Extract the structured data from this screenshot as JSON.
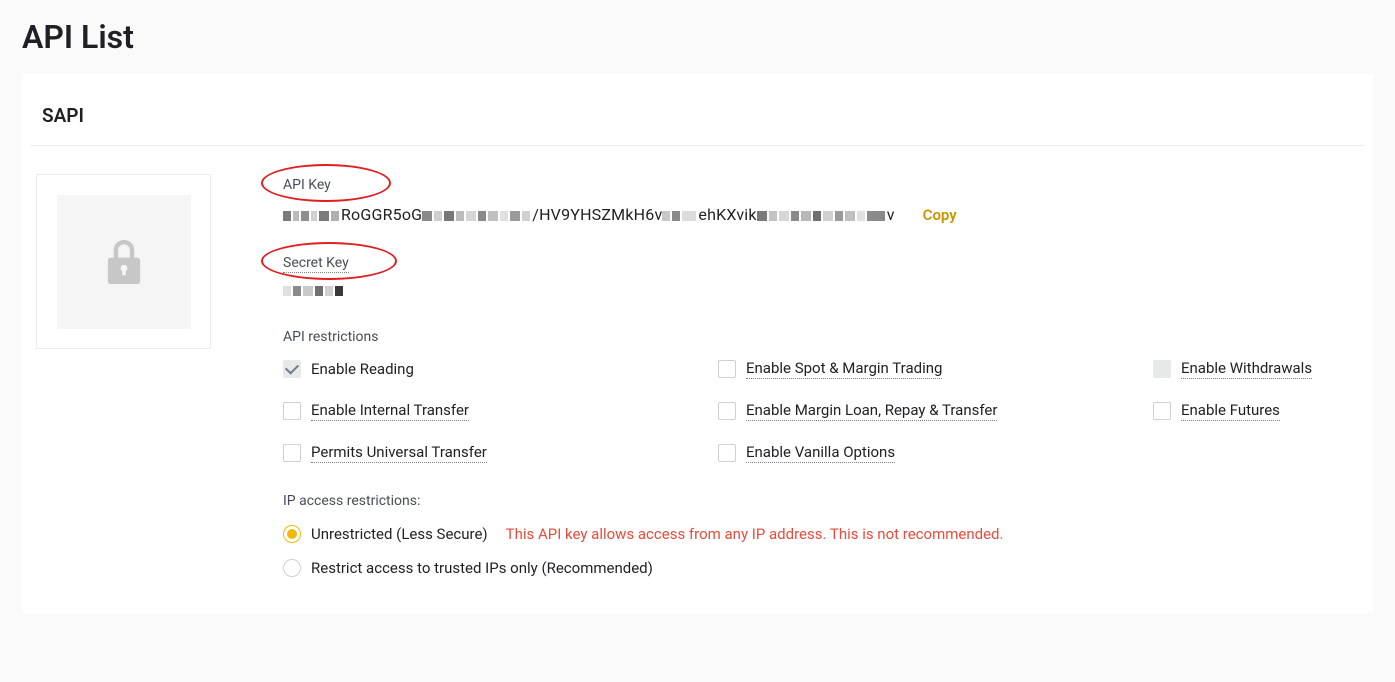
{
  "page": {
    "title": "API List"
  },
  "card": {
    "header": "SAPI",
    "apiKey": {
      "label": "API Key",
      "value_prefix": "RoGGR5oG",
      "value_mid": "/HV9YHSZMkH6v",
      "value_suffix": "ehKXvik",
      "value_end": "v",
      "copy": "Copy"
    },
    "secretKey": {
      "label": "Secret Key"
    },
    "restrictions": {
      "label": "API restrictions",
      "items": [
        {
          "label": "Enable Reading",
          "checked": true,
          "dotted": false,
          "greySolid": false
        },
        {
          "label": "Enable Spot & Margin Trading",
          "checked": false,
          "dotted": true,
          "greySolid": false
        },
        {
          "label": "Enable Withdrawals",
          "checked": false,
          "dotted": true,
          "greySolid": true
        },
        {
          "label": "Enable Internal Transfer",
          "checked": false,
          "dotted": true,
          "greySolid": false
        },
        {
          "label": "Enable Margin Loan, Repay & Transfer",
          "checked": false,
          "dotted": true,
          "greySolid": false
        },
        {
          "label": "Enable Futures",
          "checked": false,
          "dotted": true,
          "greySolid": false
        },
        {
          "label": "Permits Universal Transfer",
          "checked": false,
          "dotted": true,
          "greySolid": false
        },
        {
          "label": "Enable Vanilla Options",
          "checked": false,
          "dotted": true,
          "greySolid": false
        }
      ]
    },
    "ipAccess": {
      "label": "IP access restrictions:",
      "options": [
        {
          "label": "Unrestricted (Less Secure)",
          "selected": true,
          "warning": "This API key allows access from any IP address. This is not recommended."
        },
        {
          "label": "Restrict access to trusted IPs only (Recommended)",
          "selected": false,
          "warning": ""
        }
      ]
    }
  }
}
